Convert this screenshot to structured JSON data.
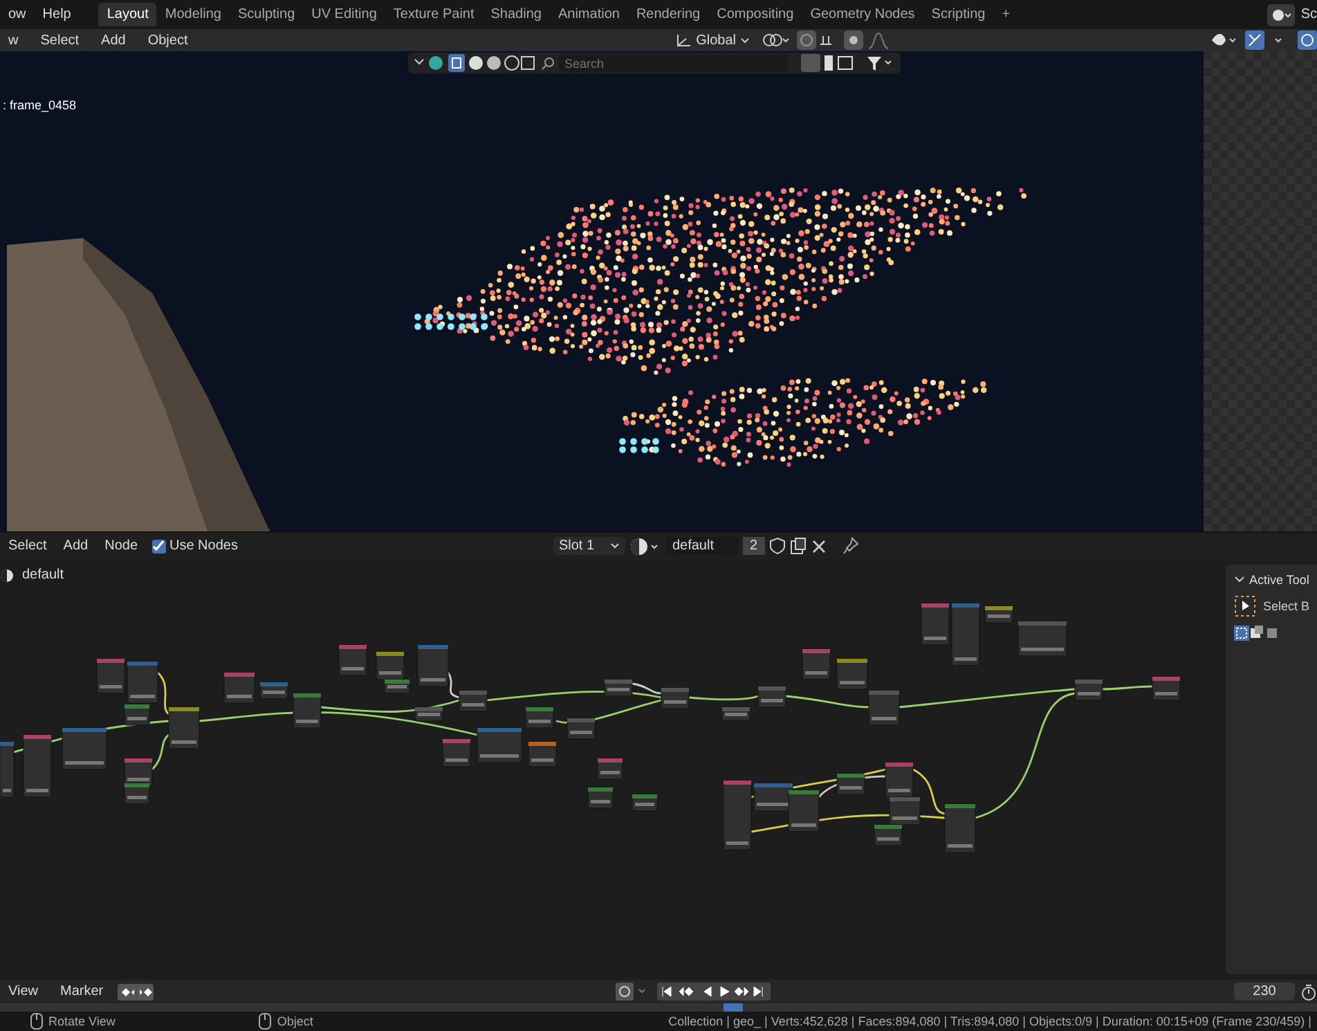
{
  "top_menu": [
    "ow",
    "Help"
  ],
  "workspace_tabs": [
    {
      "label": "Layout",
      "selected": true
    },
    {
      "label": "Modeling",
      "selected": false
    },
    {
      "label": "Sculpting",
      "selected": false
    },
    {
      "label": "UV Editing",
      "selected": false
    },
    {
      "label": "Texture Paint",
      "selected": false
    },
    {
      "label": "Shading",
      "selected": false
    },
    {
      "label": "Animation",
      "selected": false
    },
    {
      "label": "Rendering",
      "selected": false
    },
    {
      "label": "Compositing",
      "selected": false
    },
    {
      "label": "Geometry Nodes",
      "selected": false
    },
    {
      "label": "Scripting",
      "selected": false
    }
  ],
  "add_tab": "+",
  "scene": "Sc",
  "viewport": {
    "menu": [
      "w",
      "Select",
      "Add",
      "Object"
    ],
    "orientation": "Global",
    "search": {
      "placeholder": "Search"
    },
    "overlay_text": ": frame_0458"
  },
  "node_editor": {
    "menu": [
      "Select",
      "Add",
      "Node"
    ],
    "use_nodes": {
      "label": "Use Nodes",
      "checked": true
    },
    "slot": "Slot 1",
    "material": "default",
    "users": "2",
    "breadcrumb": "default"
  },
  "sidebar": {
    "panel_title": "Active Tool",
    "tool": "Select B"
  },
  "timeline": {
    "menu": [
      "View",
      "Marker"
    ],
    "current_frame": "230"
  },
  "status_bar": {
    "hints": [
      "Rotate View",
      "Object"
    ],
    "stats": "Collection | geo_ | Verts:452,628 | Faces:894,080 | Tris:894,080 | Objects:0/9 | Duration: 00:15+09 (Frame 230/459) |"
  }
}
